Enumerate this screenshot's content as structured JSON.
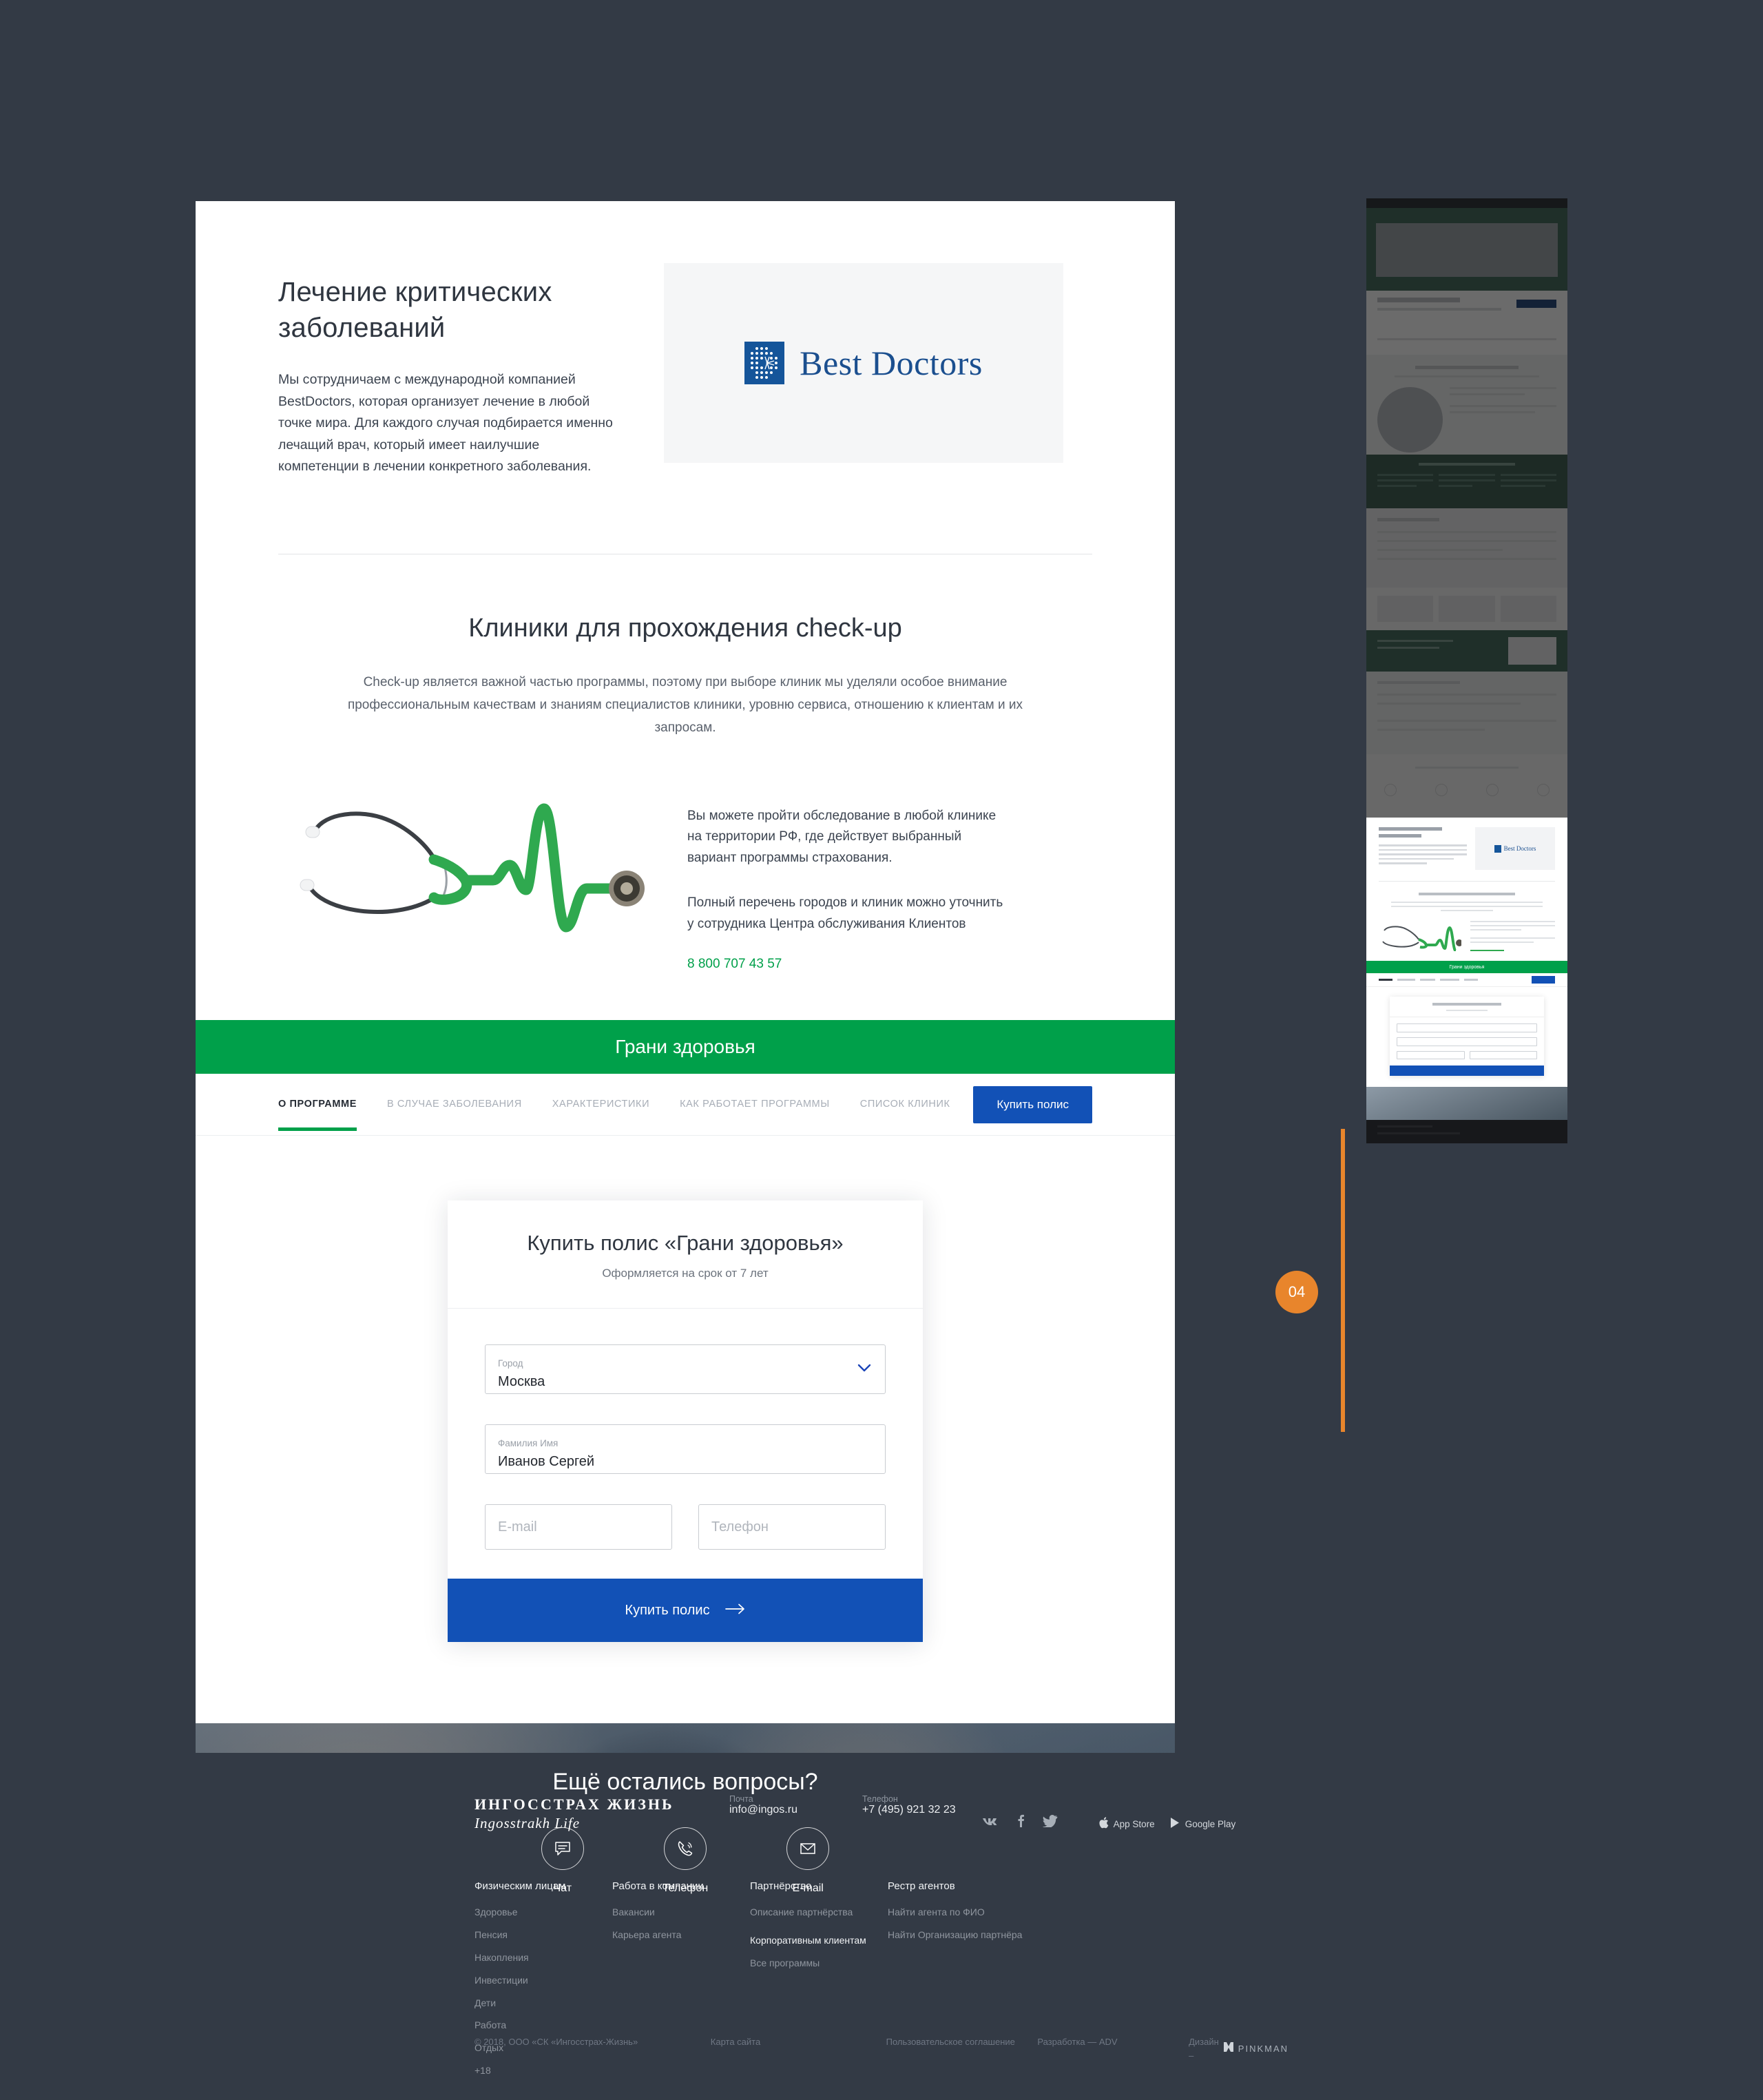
{
  "hero": {
    "title": "Лечение критических заболеваний",
    "body": "Мы сотрудничаем с международной компанией BestDoctors, которая организует лечение в любой точке мира. Для каждого случая подбирается именно лечащий врач, который имеет наилучшие компетенции в лечении конкретного заболевания.",
    "partner_logo_text": "Best Doctors",
    "partner_logo_color": "#15559a"
  },
  "checkup": {
    "title": "Клиники для прохождения check-up",
    "intro": "Check-up является важной частью программы, поэтому при выборе клиник мы уделяли особое внимание профессиональным качествам и знаниям специалистов клиники, уровню сервиса, отношению к клиентам и их запросам.",
    "para1": "Вы можете пройти обследование в любой клинике на территории РФ, где действует выбранный вариант программы страхования.",
    "para2": "Полный перечень городов и клиник можно уточнить у сотрудника Центра обслуживания Клиентов",
    "phone": "8 800 707 43 57",
    "phone_color": "#00a04a",
    "image_name": "stethoscope-ecg-image"
  },
  "band": {
    "title": "Грани здоровья",
    "color": "#00a04a"
  },
  "nav": {
    "tabs": [
      {
        "label": "О ПРОГРАММЕ",
        "active": true
      },
      {
        "label": "В СЛУЧАЕ ЗАБОЛЕВАНИЯ",
        "active": false
      },
      {
        "label": "ХАРАКТЕРИСТИКИ",
        "active": false
      },
      {
        "label": "КАК РАБОТАЕТ ПРОГРАММЫ",
        "active": false
      },
      {
        "label": "СПИСОК КЛИНИК",
        "active": false
      }
    ],
    "buy_button": "Купить полис",
    "buy_button_color": "#1251b6"
  },
  "form": {
    "title": "Купить полис «Грани здоровья»",
    "subtitle": "Оформляется на срок от 7 лет",
    "city": {
      "label": "Город",
      "value": "Москва"
    },
    "name": {
      "label": "Фамилия Имя",
      "value": "Иванов Сергей"
    },
    "email": {
      "placeholder": "E-mail",
      "value": ""
    },
    "phone": {
      "placeholder": "Телефон",
      "value": ""
    },
    "submit": "Купить полис"
  },
  "questions": {
    "title": "Ещё остались вопросы?",
    "items": [
      {
        "icon": "chat-icon",
        "label": "Чат"
      },
      {
        "icon": "phone-icon",
        "label": "Телефон"
      },
      {
        "icon": "mail-icon",
        "label": "E-mail"
      }
    ]
  },
  "footer": {
    "logo_line1": "ИНГОССТРАХ ЖИЗНЬ",
    "logo_line2": "Ingosstrakh Life",
    "mail_label": "Почта",
    "mail_value": "info@ingos.ru",
    "phone_label": "Телефон",
    "phone_value": "+7 (495) 921 32 23",
    "social": [
      "vk-icon",
      "facebook-icon",
      "twitter-icon"
    ],
    "stores": [
      {
        "icon": "apple-icon",
        "label": "App Store"
      },
      {
        "icon": "google-play-icon",
        "label": "Google Play"
      }
    ],
    "columns": [
      {
        "heading": "Физическим лицам",
        "links": [
          "Здоровье",
          "Пенсия",
          "Накопления",
          "Инвестиции",
          "Дети",
          "Работа",
          "Отдых",
          "+18"
        ]
      },
      {
        "heading": "Работа в компании",
        "links": [
          "Вакансии",
          "Карьера агента"
        ]
      },
      {
        "heading": "Партнёрство",
        "links": [
          "Описание партнёрства"
        ],
        "sub_heading": "Корпоративным клиентам",
        "sub_links": [
          "Все программы"
        ]
      },
      {
        "heading": "Рестр агентов",
        "links": [
          "Найти агента по ФИО",
          "Найти Организацию партнёра"
        ]
      }
    ],
    "bottom": {
      "copyright": "© 2018, ООО «СК «Ингосстрах-Жизнь»",
      "sitemap": "Карта сайта",
      "agreement": "Пользовательское соглашение",
      "dev": "Разработка — ADV",
      "design_label": "Дизайн –",
      "design_studio": "PINKMAN"
    }
  },
  "preview": {
    "marker_number": "04",
    "marker_color": "#e8852c"
  }
}
